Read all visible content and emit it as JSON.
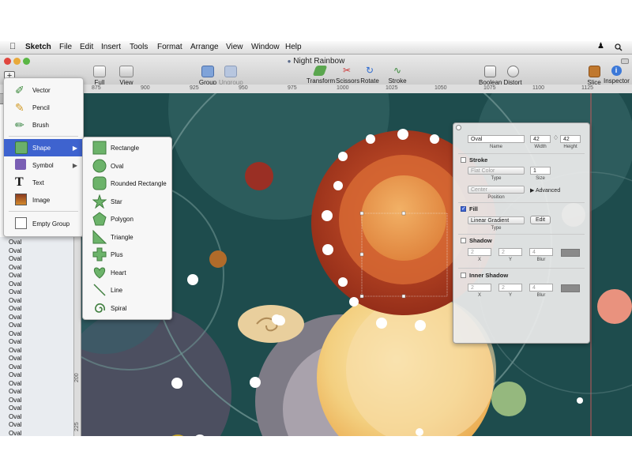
{
  "menubar": {
    "app": "Sketch",
    "items": [
      "File",
      "Edit",
      "Insert",
      "Tools",
      "Format",
      "Arrange",
      "View",
      "Window",
      "Help"
    ]
  },
  "window": {
    "title": "Night Rainbow"
  },
  "toolbar": {
    "full_screen": "Full Screen",
    "view": "View",
    "group": "Group",
    "ungroup": "Ungroup",
    "transform": "Transform",
    "scissors": "Scissors",
    "rotate": "Rotate",
    "stroke_width": "Stroke Width",
    "boolean": "Boolean",
    "distort": "Distort",
    "slice": "Slice",
    "inspector": "Inspector",
    "plus": "+"
  },
  "ruler": {
    "labels": [
      "875",
      "900",
      "925",
      "950",
      "975",
      "1000",
      "1025",
      "1050",
      "1075",
      "1100",
      "1125"
    ]
  },
  "vruler": {
    "labels": [
      "200",
      "225"
    ]
  },
  "layers": {
    "rows": [
      "Oval",
      "Oval",
      "Oval",
      "Oval",
      "Oval",
      "Oval",
      "Oval",
      "Oval",
      "Oval",
      "Oval",
      "Oval",
      "Oval",
      "Oval",
      "Oval",
      "Oval",
      "Oval",
      "Oval",
      "Oval",
      "Oval",
      "Oval",
      "Oval",
      "Oval",
      "Oval",
      "Oval"
    ]
  },
  "insert_menu": {
    "items": [
      {
        "label": "Vector",
        "icon": "vector-pen-icon"
      },
      {
        "label": "Pencil",
        "icon": "pencil-icon"
      },
      {
        "label": "Brush",
        "icon": "brush-icon"
      },
      {
        "label": "Shape",
        "icon": "shape-icon",
        "selected": true
      },
      {
        "label": "Symbol",
        "icon": "symbol-icon"
      },
      {
        "label": "Text",
        "icon": "text-icon"
      },
      {
        "label": "Image",
        "icon": "image-icon"
      },
      {
        "label": "Empty Group",
        "icon": "empty-group-icon"
      }
    ]
  },
  "shape_menu": {
    "items": [
      "Rectangle",
      "Oval",
      "Rounded Rectangle",
      "Star",
      "Polygon",
      "Triangle",
      "Plus",
      "Heart",
      "Line",
      "Spiral"
    ]
  },
  "inspector": {
    "name_value": "Oval",
    "name_label": "Name",
    "width_value": "42",
    "width_label": "Width",
    "height_value": "42",
    "height_label": "Height",
    "stroke": "Stroke",
    "stroke_type": "Flat Color",
    "type_label": "Type",
    "size_value": "1",
    "size_label": "Size",
    "position_value": "Center",
    "position_label": "Position",
    "advanced": "Advanced",
    "fill": "Fill",
    "fill_type": "Linear Gradient",
    "fill_type_label": "Type",
    "edit": "Edit",
    "shadow": "Shadow",
    "shadow_x": "2",
    "shadow_y": "2",
    "shadow_blur": "4",
    "x_label": "X",
    "y_label": "Y",
    "blur_label": "Blur",
    "inner_shadow": "Inner Shadow",
    "inner_x": "2",
    "inner_y": "2",
    "inner_blur": "4"
  },
  "colors": {
    "canvas_bg": "#1e4c4d",
    "menu_selection": "#3e63cf",
    "selected_oval": "#a8361c"
  }
}
